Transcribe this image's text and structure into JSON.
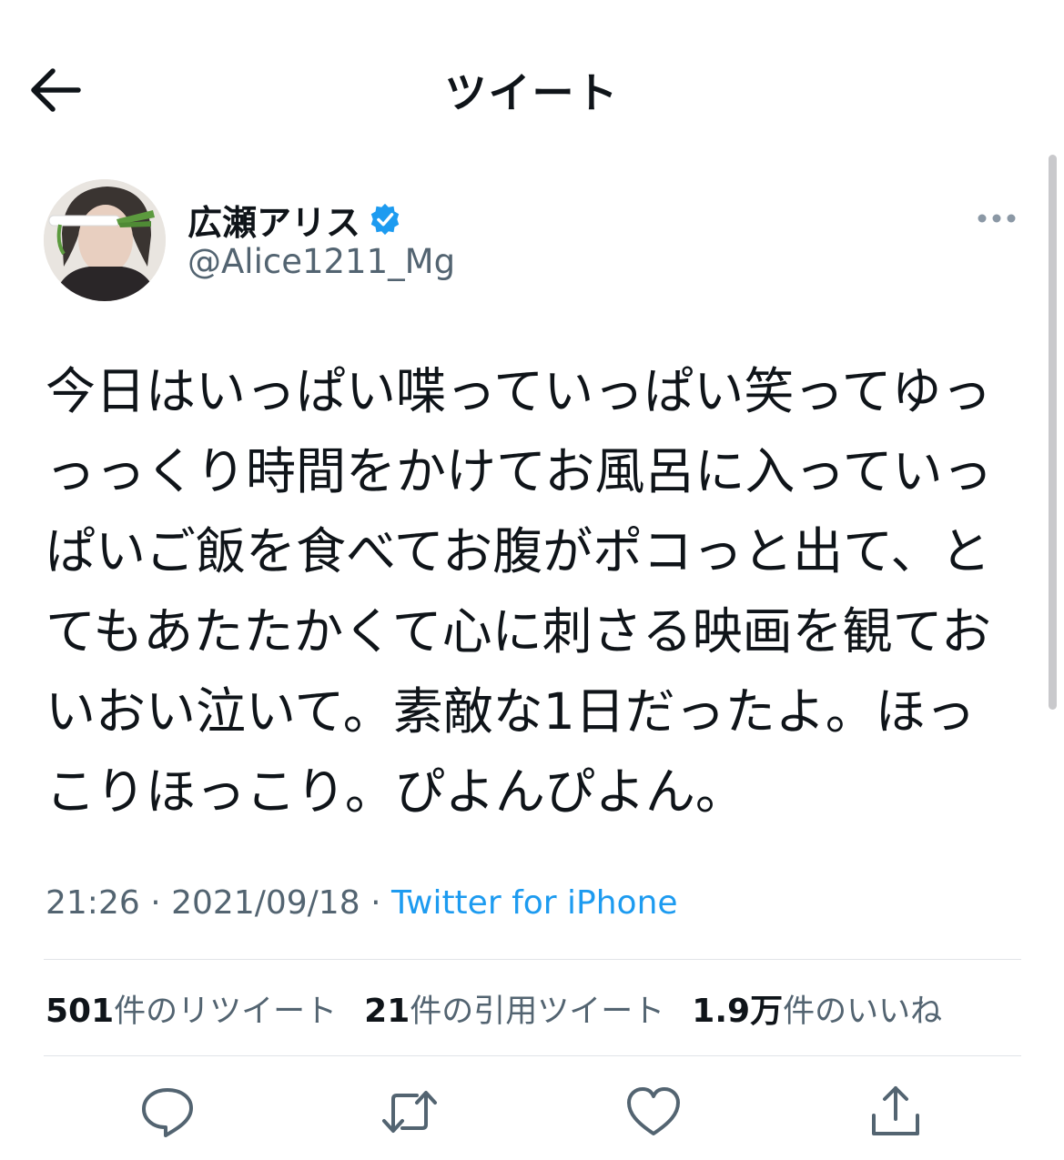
{
  "header": {
    "title": "ツイート",
    "back_icon": "arrow-left-icon"
  },
  "tweet": {
    "author": {
      "display_name": "広瀬アリス",
      "handle": "@Alice1211_Mg",
      "verified": true,
      "verified_color": "#1d9bf0"
    },
    "text_lines": [
      "今日はいっぱい喋っていっぱい笑ってゆっ",
      "っっくり時間をかけてお風呂に入っていっ",
      "ぱいご飯を食べてお腹がポコっと出て、と",
      "てもあたたかくて心に刺さる映画を観てお",
      "いおい泣いて。素敵な1日だったよ。ほっ",
      "こりほっこり。ぴよんぴよん。"
    ],
    "time": "21:26",
    "date": "2021/09/18",
    "separator": "·",
    "source": "Twitter for iPhone",
    "stats": {
      "retweets_count": "501",
      "retweets_label": "件のリツイート",
      "quotes_count": "21",
      "quotes_label": "件の引用ツイート",
      "likes_count": "1.9万",
      "likes_label": "件のいいね"
    }
  },
  "actions": [
    {
      "name": "reply",
      "icon": "reply-icon"
    },
    {
      "name": "retweet",
      "icon": "retweet-icon"
    },
    {
      "name": "like",
      "icon": "heart-icon"
    },
    {
      "name": "share",
      "icon": "share-icon"
    }
  ],
  "colors": {
    "text_primary": "#0f1419",
    "text_secondary": "#536471",
    "accent": "#1d9bf0",
    "divider": "#e1e4e8"
  }
}
